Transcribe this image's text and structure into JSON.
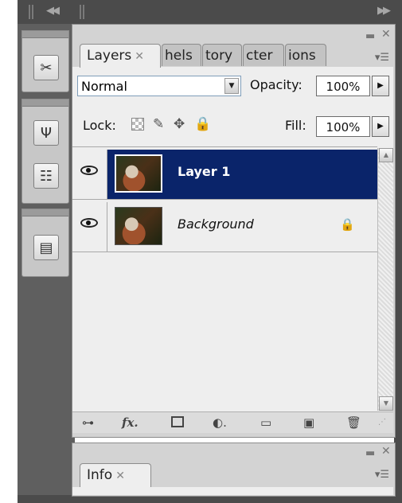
{
  "layers_panel": {
    "tabs": [
      "Layers",
      "hels",
      "tory",
      "cter",
      "ions"
    ],
    "blend_mode": "Normal",
    "opacity_label": "Opacity:",
    "opacity_value": "100%",
    "lock_label": "Lock:",
    "fill_label": "Fill:",
    "fill_value": "100%",
    "layers": [
      {
        "name": "Layer 1",
        "visible": true,
        "selected": true
      },
      {
        "name": "Background",
        "visible": true,
        "selected": false,
        "locked": true
      }
    ]
  },
  "info_panel": {
    "tab": "Info"
  },
  "colors": {
    "selection": "#0a246a",
    "panel_bg": "#eeeeee",
    "workspace": "#5f5f5f"
  }
}
